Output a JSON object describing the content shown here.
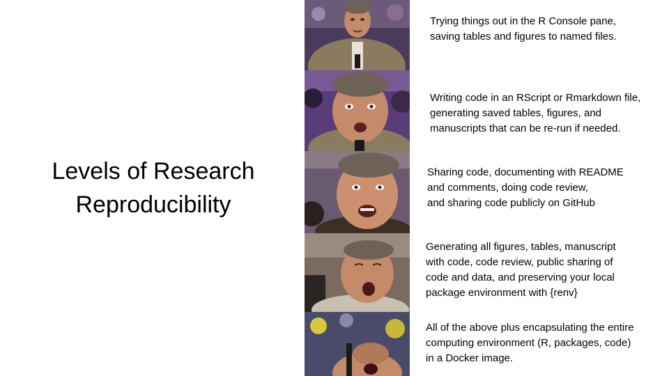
{
  "slide": {
    "title_lines": [
      "Levels of Research",
      "Reproducibility"
    ]
  },
  "panels": [
    {
      "image": "meme-face-calm",
      "caption_lines": [
        "Trying things out in the R Console pane,",
        "saving tables and figures to named files."
      ]
    },
    {
      "image": "meme-face-interested",
      "caption_lines": [
        "Writing code in an RScript or Rmarkdown file,",
        "generating saved tables, figures, and",
        "manuscripts that can be re-run if needed."
      ]
    },
    {
      "image": "meme-face-excited",
      "caption_lines": [
        "Sharing code, documenting with README",
        "and comments, doing code review,",
        "and sharing code publicly on GitHub"
      ]
    },
    {
      "image": "meme-face-ecstatic",
      "caption_lines": [
        "Generating all figures, tables, manuscript",
        "with code, code review, public sharing of",
        "code and data, and preserving your local",
        "package environment with {renv}"
      ]
    },
    {
      "image": "meme-face-overjoyed",
      "caption_lines": [
        "All of the above plus encapsulating the entire",
        "computing environment (R, packages, code)",
        "in a Docker image."
      ]
    }
  ],
  "colors": {
    "background": "#ffffff",
    "text": "#000000",
    "strip": "#111111",
    "crowd_purple": "#5a3c78",
    "skin": "#c48a6a",
    "hair": "#6e6258",
    "suit": "#8a7a5e"
  }
}
